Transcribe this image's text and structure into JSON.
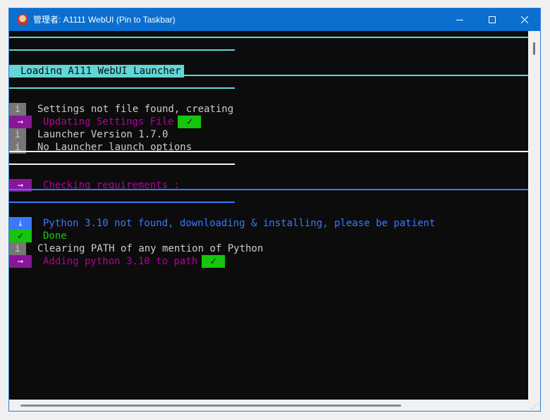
{
  "window": {
    "title": "管理者: A1111 WebUI (Pin to Taskbar)",
    "icon": "app-avatar-icon"
  },
  "controls": {
    "minimize": "─",
    "maximize": "☐",
    "close": "✕"
  },
  "colors": {
    "titlebar": "#0a6fcf",
    "terminal_bg": "#0c0c0c",
    "cyan": "#61d6d6",
    "magenta_badge": "#881798",
    "magenta_text": "#b4009e",
    "gray_badge": "#767676",
    "gray_text": "#cccccc",
    "green": "#16c60c",
    "blue": "#3b78ff",
    "white": "#f2f2f2"
  },
  "terminal": {
    "banner": "Loading A111 WebUI Launcher",
    "lines": [
      {
        "badge": "i",
        "text": "Settings not file found, creating"
      },
      {
        "badge": "→",
        "text": "Updating Settings File",
        "check": "✓"
      },
      {
        "badge": "i",
        "text": "Launcher Version 1.7.0"
      },
      {
        "badge": "i",
        "text": "No Launcher launch options"
      },
      {
        "badge": "→",
        "text": "Checking requirements :"
      },
      {
        "badge": "↓",
        "text": "Python 3.10 not found, downloading & installing, please be patient"
      },
      {
        "badge": "✓",
        "text": "Done"
      },
      {
        "badge": "i",
        "text": "Clearing PATH of any mention of Python"
      },
      {
        "badge": "→",
        "text": "Adding python 3.10 to path",
        "check": "✓"
      }
    ]
  }
}
